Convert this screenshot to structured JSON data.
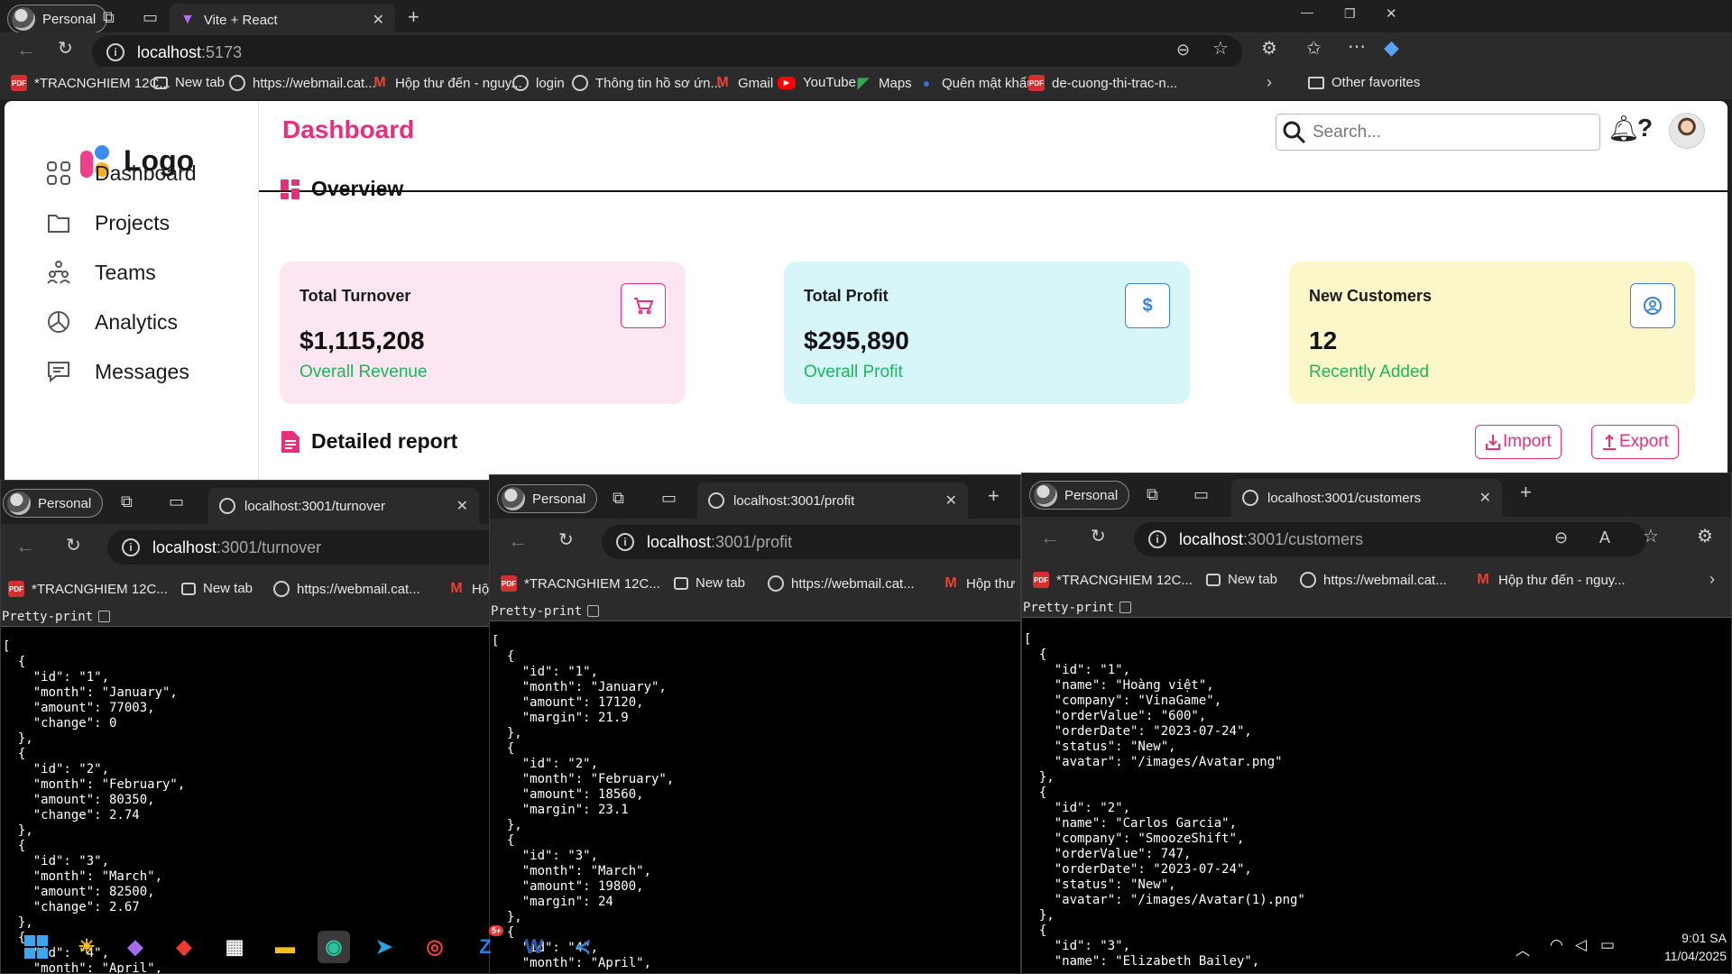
{
  "main_browser": {
    "profile_label": "Personal",
    "tab_title": "Vite + React",
    "address_host": "localhost",
    "address_path": ":5173",
    "bookmarks": [
      "*TRACNGHIEM 12C...",
      "New tab",
      "https://webmail.cat...",
      "Hộp thư đến - nguy...",
      "login",
      "Thông tin hồ sơ ứn...",
      "Gmail",
      "YouTube",
      "Maps",
      "Quên mật khẩu",
      "de-cuong-thi-trac-n..."
    ],
    "other_favorites": "Other favorites"
  },
  "app": {
    "logo_text": "Logo",
    "sidebar": [
      {
        "label": "Dashboard",
        "icon": "grid-icon"
      },
      {
        "label": "Projects",
        "icon": "folder-icon"
      },
      {
        "label": "Teams",
        "icon": "people-icon"
      },
      {
        "label": "Analytics",
        "icon": "pie-chart-icon"
      },
      {
        "label": "Messages",
        "icon": "message-icon"
      }
    ],
    "page_title": "Dashboard",
    "search_placeholder": "Search...",
    "overview_title": "Overview",
    "cards": [
      {
        "title": "Total Turnover",
        "value": "$1,115,208",
        "subtitle": "Overall Revenue",
        "icon": "cart-icon",
        "bg": "#fce6f1",
        "accent": "#e6307e"
      },
      {
        "title": "Total Profit",
        "value": "$295,890",
        "subtitle": "Overall Profit",
        "icon": "dollar-icon",
        "bg": "#d6f6fa",
        "accent": "#3a82e0"
      },
      {
        "title": "New Customers",
        "value": "12",
        "subtitle": "Recently Added",
        "icon": "user-circle-icon",
        "bg": "#fbf7c9",
        "accent": "#3a82e0"
      }
    ],
    "detailed_report_title": "Detailed report",
    "import_label": "Import",
    "export_label": "Export",
    "brand_color": "#e6307e",
    "positive_color": "#1fb45d"
  },
  "windows": [
    {
      "profile_label": "Personal",
      "tab_title": "localhost:3001/turnover",
      "address_host": "localhost",
      "address_path": ":3001/turnover",
      "bookmarks": [
        "*TRACNGHIEM 12C...",
        "New tab",
        "https://webmail.cat...",
        "Hộ"
      ],
      "pretty_print_label": "Pretty-print",
      "json_text": "[\n  {\n    \"id\": \"1\",\n    \"month\": \"January\",\n    \"amount\": 77003,\n    \"change\": 0\n  },\n  {\n    \"id\": \"2\",\n    \"month\": \"February\",\n    \"amount\": 80350,\n    \"change\": 2.74\n  },\n  {\n    \"id\": \"3\",\n    \"month\": \"March\",\n    \"amount\": 82500,\n    \"change\": 2.67\n  },\n  {\n    \"id\": \"4\",\n    \"month\": \"April\","
    },
    {
      "profile_label": "Personal",
      "tab_title": "localhost:3001/profit",
      "address_host": "localhost",
      "address_path": ":3001/profit",
      "bookmarks": [
        "*TRACNGHIEM 12C...",
        "New tab",
        "https://webmail.cat...",
        "Hộp thư"
      ],
      "pretty_print_label": "Pretty-print",
      "json_text": "[\n  {\n    \"id\": \"1\",\n    \"month\": \"January\",\n    \"amount\": 17120,\n    \"margin\": 21.9\n  },\n  {\n    \"id\": \"2\",\n    \"month\": \"February\",\n    \"amount\": 18560,\n    \"margin\": 23.1\n  },\n  {\n    \"id\": \"3\",\n    \"month\": \"March\",\n    \"amount\": 19800,\n    \"margin\": 24\n  },\n  {\n    \"id\": \"4\",\n    \"month\": \"April\","
    },
    {
      "profile_label": "Personal",
      "tab_title": "localhost:3001/customers",
      "address_host": "localhost",
      "address_path": ":3001/customers",
      "bookmarks": [
        "*TRACNGHIEM 12C...",
        "New tab",
        "https://webmail.cat...",
        "Hộp thư đến - nguy..."
      ],
      "pretty_print_label": "Pretty-print",
      "json_text": "[\n  {\n    \"id\": \"1\",\n    \"name\": \"Hoàng việt\",\n    \"company\": \"VinaGame\",\n    \"orderValue\": \"600\",\n    \"orderDate\": \"2023-07-24\",\n    \"status\": \"New\",\n    \"avatar\": \"/images/Avatar.png\"\n  },\n  {\n    \"id\": \"2\",\n    \"name\": \"Carlos Garcia\",\n    \"company\": \"SmoozeShift\",\n    \"orderValue\": 747,\n    \"orderDate\": \"2023-07-24\",\n    \"status\": \"New\",\n    \"avatar\": \"/images/Avatar(1).png\"\n  },\n  {\n    \"id\": \"3\",\n    \"name\": \"Elizabeth Bailey\","
    }
  ],
  "taskbar": {
    "time": "9:01 SA",
    "date": "11/04/2025",
    "zalo_badge": "5+",
    "icons": [
      "windows-start-icon",
      "weather-icon",
      "copilot-icon",
      "git-icon",
      "store-icon",
      "file-explorer-icon",
      "edge-icon",
      "telegram-icon",
      "chrome-icon",
      "zalo-icon",
      "word-icon",
      "vscode-icon"
    ]
  }
}
